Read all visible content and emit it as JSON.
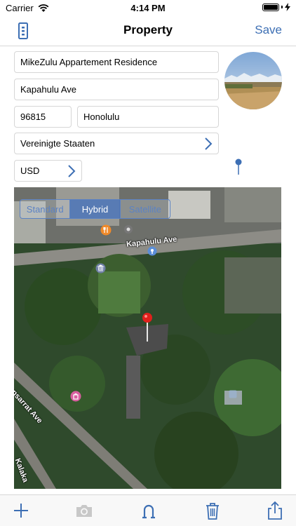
{
  "status": {
    "carrier": "Carrier",
    "time": "4:14 PM"
  },
  "nav": {
    "title": "Property",
    "save_label": "Save"
  },
  "form": {
    "name": "MikeZulu Appartement Residence",
    "street": "Kapahulu Ave",
    "zip": "96815",
    "city": "Honolulu",
    "country": "Vereinigte Staaten",
    "currency": "USD"
  },
  "map": {
    "segments": [
      "Standard",
      "Hybrid",
      "Satellite"
    ],
    "selected_segment": "Hybrid",
    "labels": {
      "kapahulu": "Kapahulu Ave",
      "monsarrat": "Monsarrat Ave",
      "kalakaua": "Kalaka"
    }
  },
  "toolbar": {
    "icons": [
      "plus-icon",
      "camera-icon",
      "magnet-icon",
      "trash-icon",
      "share-icon"
    ]
  },
  "colors": {
    "accent": "#3d6fb4",
    "pin_red": "#e0201c"
  }
}
